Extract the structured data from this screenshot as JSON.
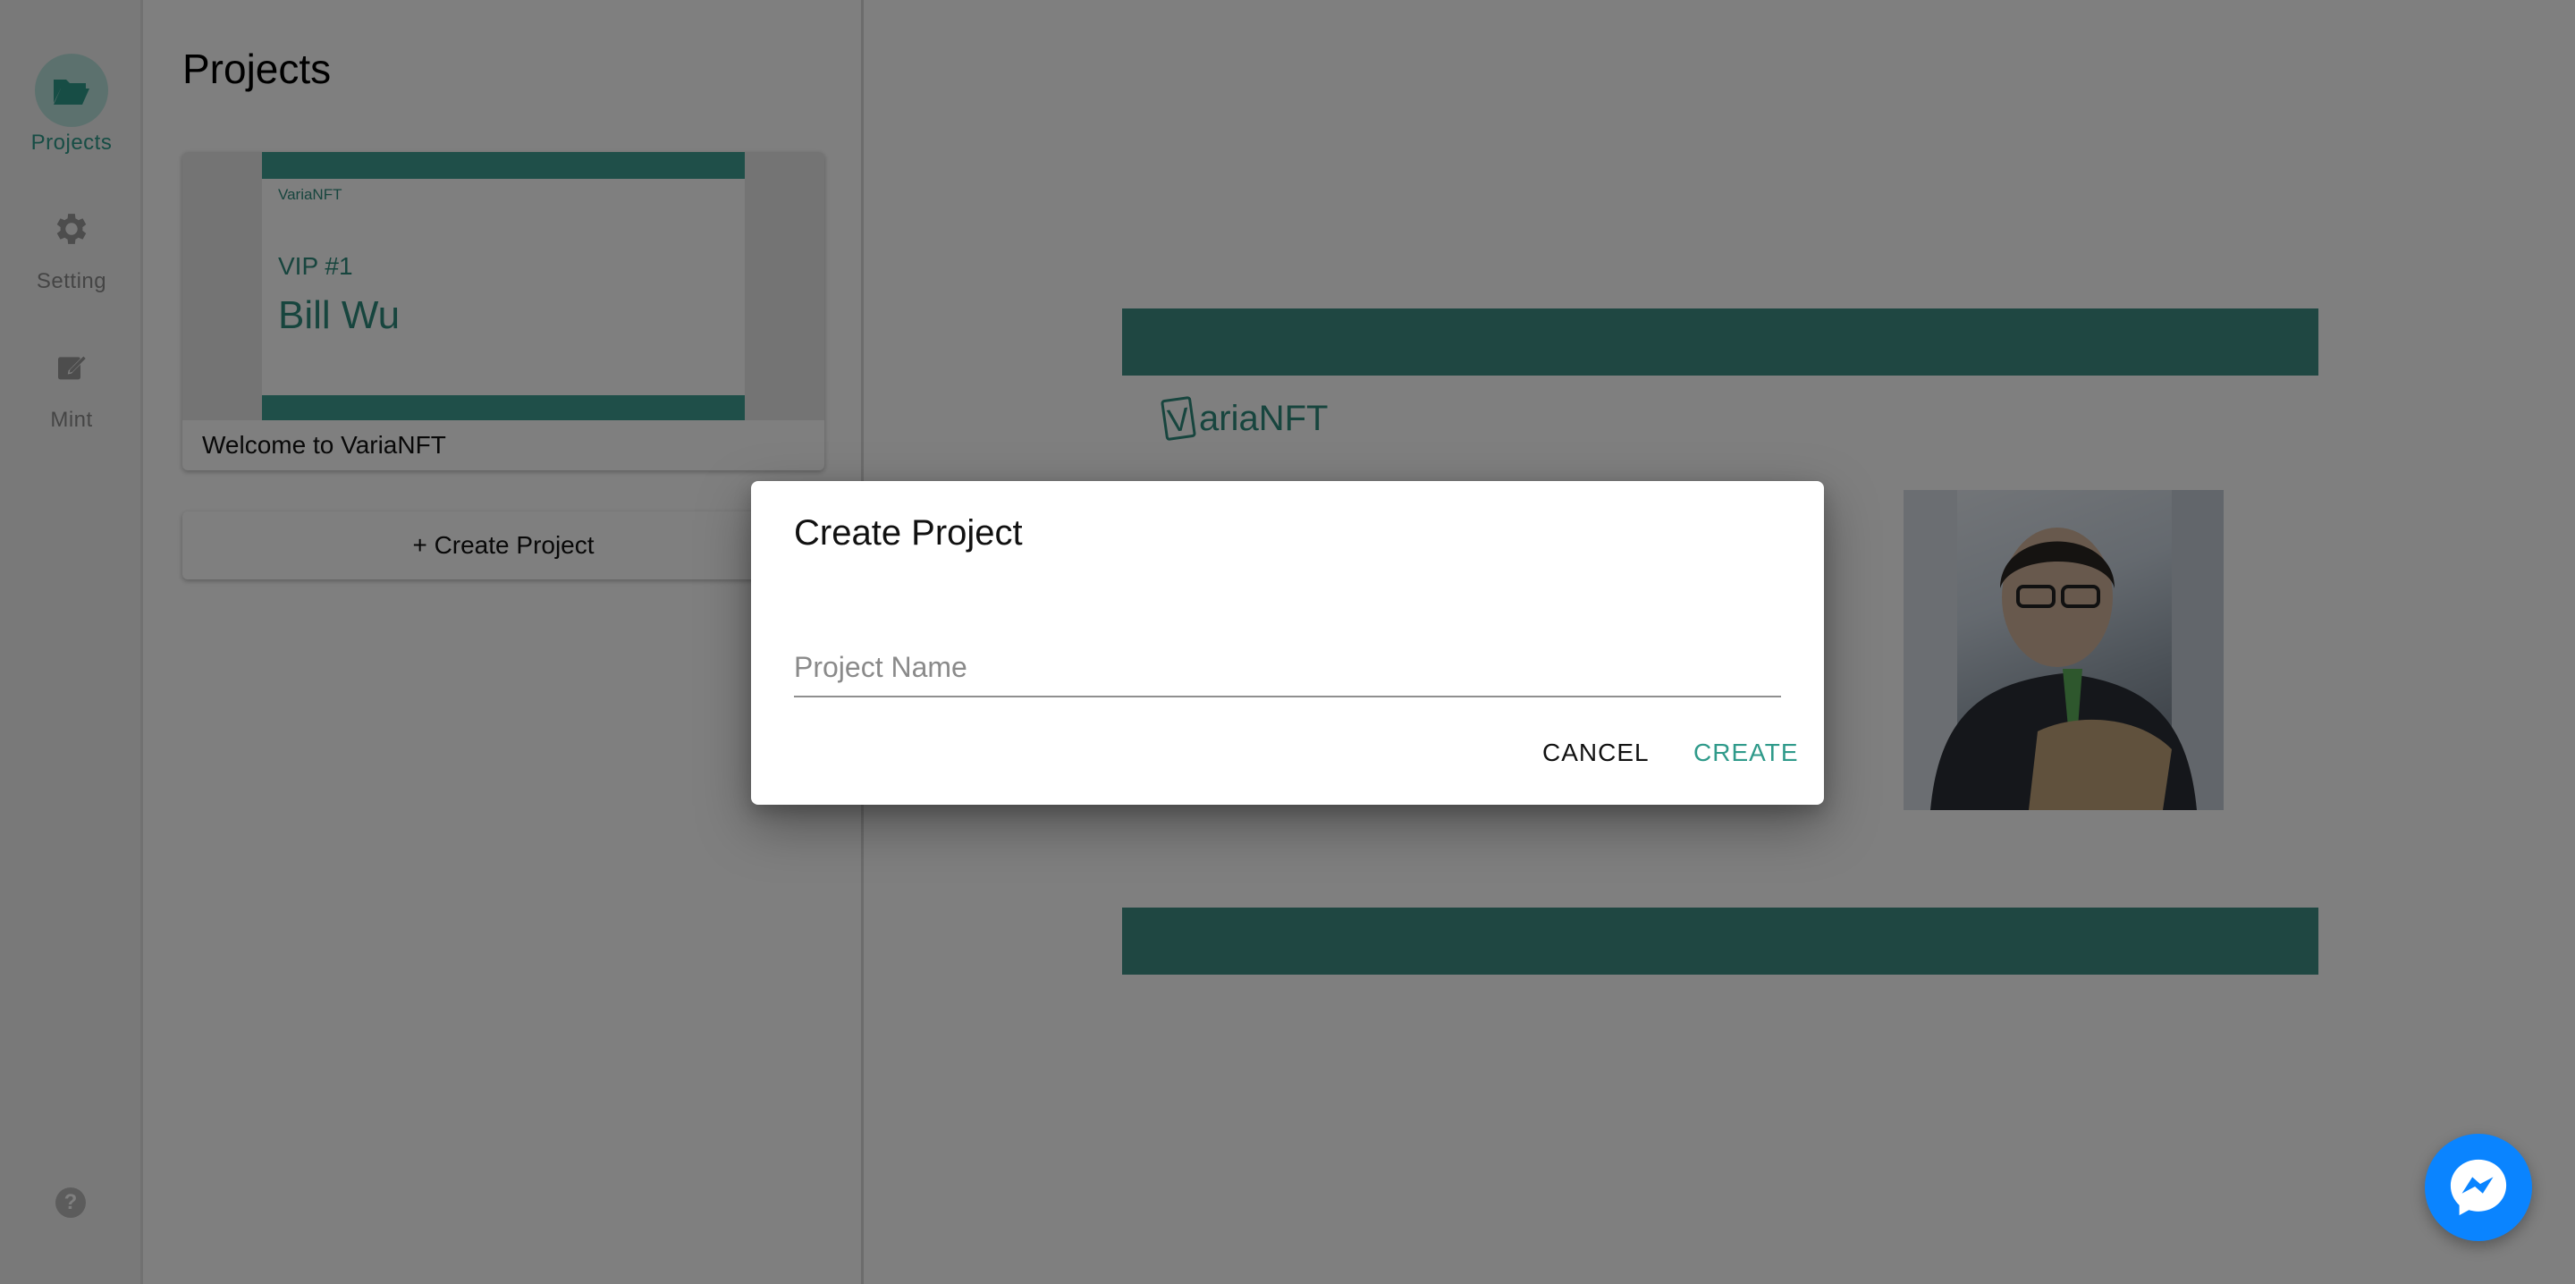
{
  "nav": {
    "items": [
      {
        "label": "Projects",
        "icon": "folder-open-icon",
        "active": true
      },
      {
        "label": "Setting",
        "icon": "gear-icon",
        "active": false
      },
      {
        "label": "Mint",
        "icon": "edit-icon",
        "active": false
      }
    ],
    "help_icon": "help-icon",
    "help_glyph": "?"
  },
  "panel": {
    "title": "Projects",
    "project_card": {
      "caption": "Welcome to VariaNFT",
      "thumb_logo": "VariaNFT",
      "thumb_subtitle": "VIP #1",
      "thumb_name": "Bill Wu"
    },
    "create_button": "+ Create Project"
  },
  "preview": {
    "logo_mark": "V",
    "logo_text": "ariaNFT"
  },
  "dialog": {
    "title": "Create Project",
    "input_placeholder": "Project Name",
    "input_value": "",
    "cancel_label": "CANCEL",
    "create_label": "CREATE"
  },
  "colors": {
    "accent": "#2f9a8a",
    "band": "#3e8f85",
    "messenger": "#0a84ff"
  }
}
